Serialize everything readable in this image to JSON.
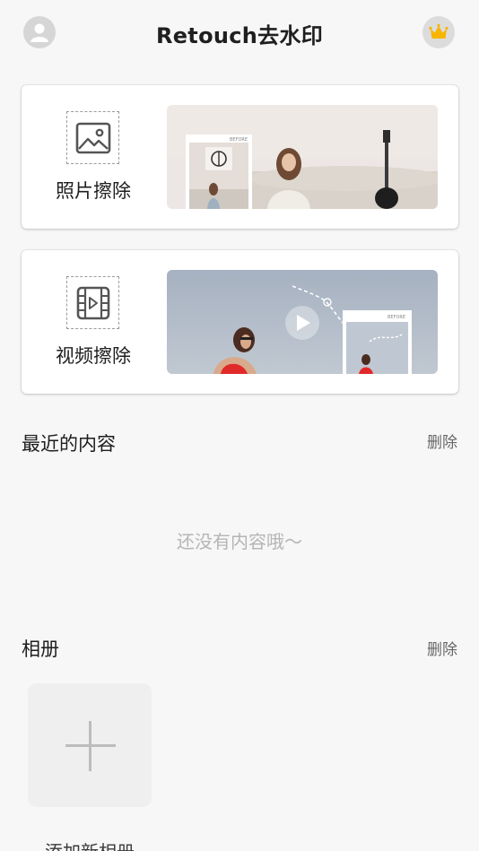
{
  "header": {
    "title": "Retouch去水印",
    "avatar_icon": "user-icon",
    "vip_icon": "crown-icon",
    "vip_color": "#f7b500"
  },
  "cards": [
    {
      "label": "照片擦除",
      "icon": "image-icon",
      "preview_badge": "BEFORE"
    },
    {
      "label": "视频擦除",
      "icon": "film-icon",
      "preview_badge": "BEFORE"
    }
  ],
  "recent": {
    "title": "最近的内容",
    "delete_label": "删除",
    "empty_text": "还没有内容哦～"
  },
  "albums": {
    "title": "相册",
    "delete_label": "删除",
    "add_label": "添加新相册"
  }
}
